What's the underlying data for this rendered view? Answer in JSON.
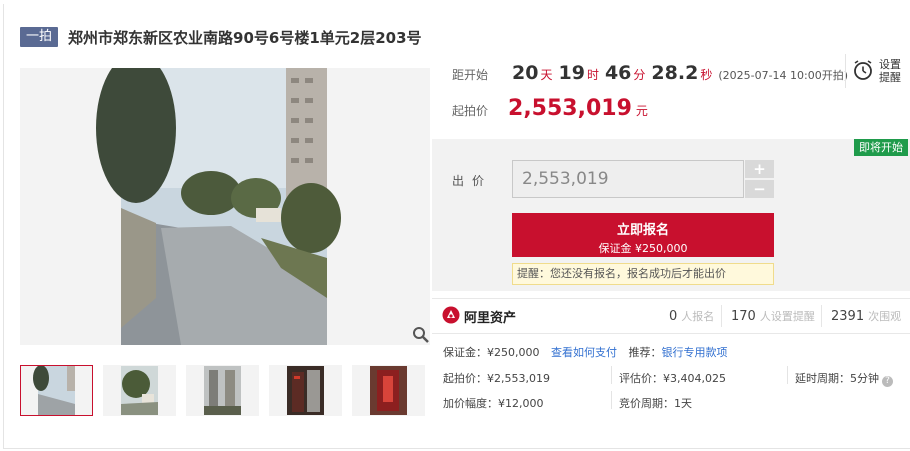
{
  "header": {
    "badge": "一拍",
    "title": "郑州市郑东新区农业南路90号6号楼1单元2层203号"
  },
  "countdown": {
    "label": "距开始",
    "days": "20",
    "days_unit": "天",
    "hours": "19",
    "hours_unit": "时",
    "minutes": "46",
    "minutes_unit": "分",
    "seconds": "28.2",
    "seconds_unit": "秒",
    "start_time": "(2025-07-14 10:00开拍)"
  },
  "reminder": {
    "label": "设置提醒",
    "icon": "alarm-clock-icon"
  },
  "starting_price": {
    "label": "起拍价",
    "value": "2,553,019",
    "unit": "元"
  },
  "bid": {
    "status_tag": "即将开始",
    "label": "出价",
    "input_value": "2,553,019",
    "plus": "+",
    "minus": "−",
    "signup_label": "立即报名",
    "deposit_sub": "保证金 ¥250,000",
    "notice": "提醒：您还没有报名，报名成功后才能出价"
  },
  "stats": {
    "brand": "阿里资产",
    "signups": "0",
    "signups_label": "人报名",
    "reminders": "170",
    "reminders_label": "人设置提醒",
    "views": "2391",
    "views_label": "次围观"
  },
  "details": {
    "deposit_label": "保证金：¥250,000",
    "pay_link": "查看如何支付",
    "recommend_label": "推荐：",
    "recommend_link": "银行专用款项",
    "start_price": "起拍价：¥2,553,019",
    "appraisal": "评估价：¥3,404,025",
    "delay": "延时周期：5分钟",
    "increment": "加价幅度：¥12,000",
    "cycle": "竞价周期：1天"
  },
  "colors": {
    "accent": "#c8102e",
    "badge": "#5a6a93",
    "status_green": "#1f9b4b",
    "link": "#3270d0"
  }
}
